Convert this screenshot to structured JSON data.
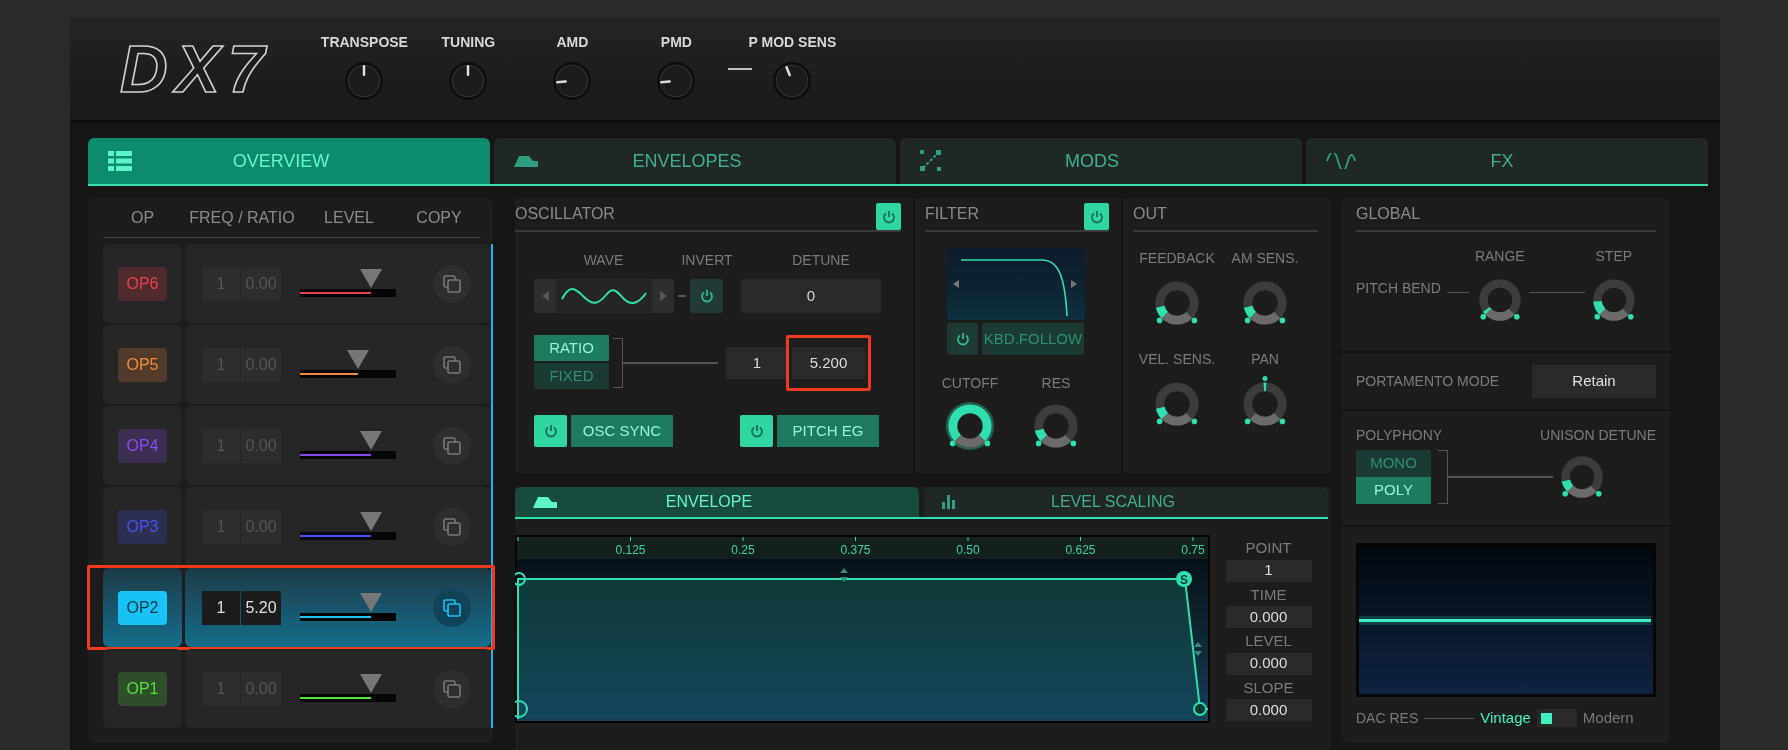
{
  "header": {
    "logo": "DX7",
    "knobs": [
      {
        "label": "TRANSPOSE"
      },
      {
        "label": "TUNING"
      },
      {
        "label": "AMD"
      },
      {
        "label": "PMD"
      },
      {
        "label": "P MOD SENS"
      }
    ]
  },
  "tabs": [
    {
      "label": "OVERVIEW",
      "selected": true
    },
    {
      "label": "ENVELOPES",
      "selected": false
    },
    {
      "label": "MODS",
      "selected": false
    },
    {
      "label": "FX",
      "selected": false
    }
  ],
  "operators": {
    "columns": [
      "OP",
      "FREQ / RATIO",
      "LEVEL",
      "COPY"
    ],
    "rows": [
      {
        "label": "OP6",
        "color": "#e8404e",
        "coarse": "1",
        "fine": "0.00",
        "level": 0.74,
        "selected": false,
        "highlighted": false
      },
      {
        "label": "OP5",
        "color": "#f08a3c",
        "coarse": "1",
        "fine": "0.00",
        "level": 0.6,
        "selected": false,
        "highlighted": false
      },
      {
        "label": "OP4",
        "color": "#8a4cf0",
        "coarse": "1",
        "fine": "0.00",
        "level": 0.74,
        "selected": false,
        "highlighted": false
      },
      {
        "label": "OP3",
        "color": "#4a50f0",
        "coarse": "1",
        "fine": "0.00",
        "level": 0.74,
        "selected": false,
        "highlighted": false
      },
      {
        "label": "OP2",
        "color": "#19c3f5",
        "coarse": "1",
        "fine": "5.20",
        "level": 0.74,
        "selected": true,
        "highlighted": true
      },
      {
        "label": "OP1",
        "color": "#52e03a",
        "coarse": "1",
        "fine": "0.00",
        "level": 0.74,
        "selected": false,
        "highlighted": false
      }
    ]
  },
  "oscillator": {
    "title": "OSCILLATOR",
    "on": true,
    "wave_label": "WAVE",
    "invert_label": "INVERT",
    "invert_on": false,
    "detune_label": "DETUNE",
    "detune": "0",
    "modes": [
      {
        "label": "RATIO",
        "selected": true
      },
      {
        "label": "FIXED",
        "selected": false
      }
    ],
    "coarse": "1",
    "fine": "5.200",
    "fine_highlighted": true,
    "toggles": [
      {
        "label": "OSC SYNC",
        "on": true
      },
      {
        "label": "PITCH EG",
        "on": true
      }
    ]
  },
  "filter": {
    "title": "FILTER",
    "on": true,
    "kbd_follow": {
      "label": "KBD.FOLLOW",
      "on": false
    },
    "knobs": [
      {
        "label": "CUTOFF"
      },
      {
        "label": "RES"
      }
    ]
  },
  "out": {
    "title": "OUT",
    "knobs": [
      {
        "label": "FEEDBACK",
        "kind": "unipolar"
      },
      {
        "label": "AM SENS.",
        "kind": "unipolar"
      },
      {
        "label": "VEL. SENS.",
        "kind": "unipolar"
      },
      {
        "label": "PAN",
        "kind": "bipolar"
      }
    ]
  },
  "envelope": {
    "tabs": [
      {
        "label": "ENVELOPE",
        "selected": true
      },
      {
        "label": "LEVEL SCALING",
        "selected": false
      }
    ],
    "ticks": [
      "0.125",
      "0.25",
      "0.375",
      "0.50",
      "0.625",
      "0.75"
    ],
    "sustain_marker": "S",
    "fields": [
      {
        "label": "POINT",
        "value": "1"
      },
      {
        "label": "TIME",
        "value": "0.000"
      },
      {
        "label": "LEVEL",
        "value": "0.000"
      },
      {
        "label": "SLOPE",
        "value": "0.000"
      }
    ]
  },
  "global": {
    "title": "GLOBAL",
    "pitch_bend_label": "PITCH BEND",
    "knobs": [
      {
        "label": "RANGE"
      },
      {
        "label": "STEP"
      }
    ],
    "portamento": {
      "label": "PORTAMENTO MODE",
      "value": "Retain"
    },
    "polyphony": {
      "label": "POLYPHONY",
      "modes": [
        {
          "label": "MONO",
          "selected": false
        },
        {
          "label": "POLY",
          "selected": true
        }
      ],
      "unison": {
        "label": "UNISON DETUNE"
      }
    },
    "dac": {
      "label": "DAC RES",
      "options": [
        {
          "label": "Vintage",
          "selected": true
        },
        {
          "label": "Modern",
          "selected": false
        }
      ]
    }
  }
}
